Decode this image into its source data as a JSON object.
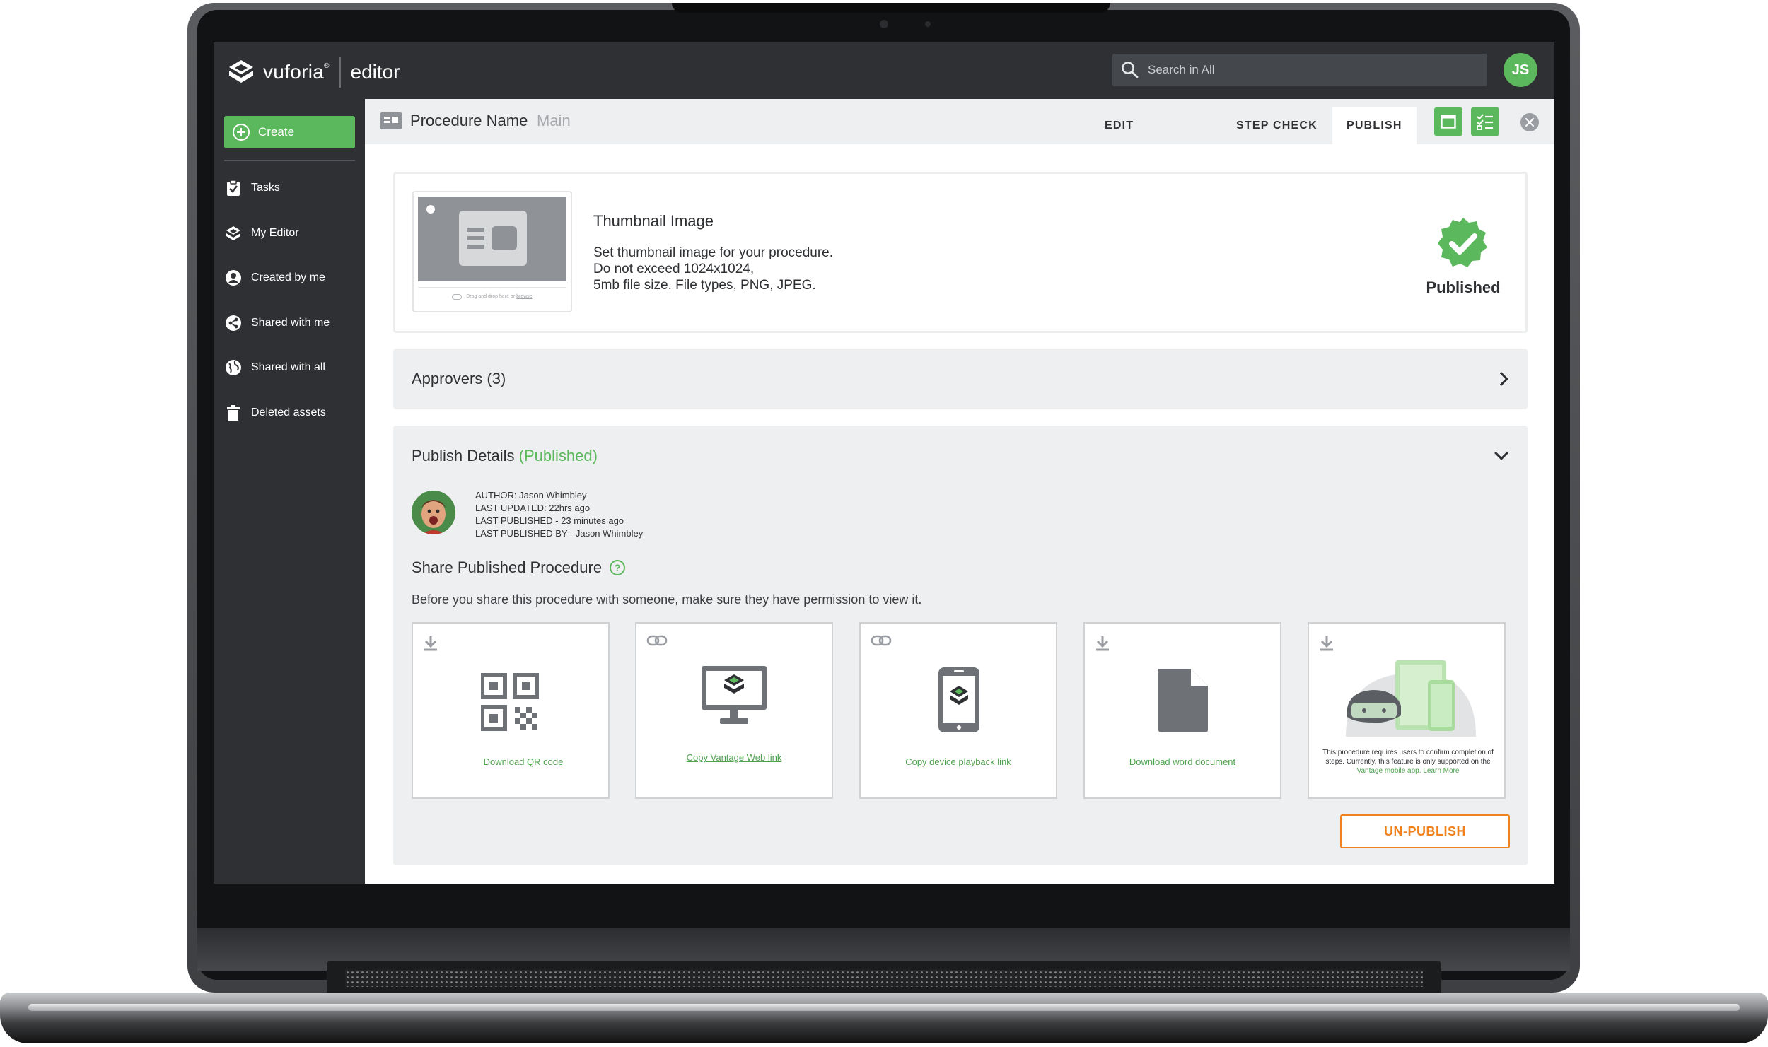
{
  "app": {
    "brand": "vuforia",
    "brand_mark": "®",
    "product": "editor",
    "search_placeholder": "Search in All",
    "user_initials": "JS"
  },
  "sidebar": {
    "create_label": "Create",
    "items": [
      {
        "label": "Tasks",
        "icon": "clipboard-check-icon"
      },
      {
        "label": "My Editor",
        "icon": "layers-icon"
      },
      {
        "label": "Created by me",
        "icon": "user-circle-icon"
      },
      {
        "label": "Shared with me",
        "icon": "share-icon"
      },
      {
        "label": "Shared with all",
        "icon": "globe-icon"
      },
      {
        "label": "Deleted assets",
        "icon": "trash-icon"
      }
    ]
  },
  "header": {
    "procedure_name": "Procedure Name",
    "branch": "Main",
    "tabs": [
      "EDIT",
      "STEP CHECK",
      "PUBLISH"
    ],
    "active_tab": "PUBLISH"
  },
  "thumbnail": {
    "title": "Thumbnail Image",
    "desc_lines": [
      "Set thumbnail image for your procedure.",
      "Do not exceed 1024x1024,",
      "5mb file size. File types, PNG, JPEG."
    ],
    "drop_hint": "Drag and drop here or",
    "drop_link": "browse",
    "status": "Published"
  },
  "approvers": {
    "title": "Approvers (3)"
  },
  "publish_details": {
    "title": "Publish Details",
    "status": "(Published)",
    "meta": [
      "AUTHOR: Jason Whimbley",
      "LAST UPDATED: 22hrs ago",
      "LAST PUBLISHED - 23 minutes ago",
      "LAST PUBLISHED BY - Jason Whimbley"
    ],
    "share_title": "Share Published Procedure",
    "share_desc": "Before you share this procedure with someone, make sure they have permission to view it.",
    "cards": [
      {
        "label": "Download QR code",
        "corner_icon": "download-icon",
        "icon": "qr-code-icon"
      },
      {
        "label": "Copy Vantage Web link",
        "corner_icon": "link-icon",
        "icon": "monitor-icon"
      },
      {
        "label": "Copy device playback link",
        "corner_icon": "link-icon",
        "icon": "phone-icon"
      },
      {
        "label": "Download word document",
        "corner_icon": "download-icon",
        "icon": "document-icon"
      },
      {
        "label": "",
        "corner_icon": "download-icon",
        "icon": "headset-devices-icon"
      }
    ],
    "vantage_note_prefix": "This procedure requires users to confirm completion of steps. Currently, this feature is only supported on the",
    "vantage_note_link": "Vantage mobile app.",
    "vantage_note_learn": "Learn More",
    "unpublish_label": "UN-PUBLISH"
  },
  "colors": {
    "brand_green": "#5cb85c",
    "dark_chrome": "#2e3033",
    "warning_orange": "#f0821e"
  }
}
